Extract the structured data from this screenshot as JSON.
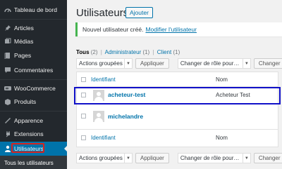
{
  "sidebar": {
    "items": [
      {
        "label": "Tableau de bord",
        "icon": "dashboard-icon"
      },
      {
        "label": "Articles",
        "icon": "pin-icon"
      },
      {
        "label": "Médias",
        "icon": "media-icon"
      },
      {
        "label": "Pages",
        "icon": "pages-icon"
      },
      {
        "label": "Commentaires",
        "icon": "comment-icon"
      },
      {
        "label": "WooCommerce",
        "icon": "woocommerce-icon"
      },
      {
        "label": "Produits",
        "icon": "products-icon"
      },
      {
        "label": "Apparence",
        "icon": "appearance-icon"
      },
      {
        "label": "Extensions",
        "icon": "plugins-icon"
      },
      {
        "label": "Utilisateurs",
        "icon": "users-icon"
      }
    ],
    "submenu_label": "Tous les utilisateurs",
    "active_color": "#0073aa"
  },
  "header": {
    "title": "Utilisateurs",
    "add_button": "Ajouter"
  },
  "notice": {
    "text": "Nouvel utilisateur créé.",
    "link": "Modifier l'utilisateur"
  },
  "filters": {
    "all": "Tous",
    "all_count": "(2)",
    "admin": "Administrateur",
    "admin_count": "(1)",
    "client": "Client",
    "client_count": "(1)",
    "separator": "|"
  },
  "toolbar_top": {
    "bulk_select": "Actions groupées",
    "apply": "Appliquer",
    "role_select": "Changer de rôle pour…",
    "change": "Changer"
  },
  "toolbar_bottom": {
    "bulk_select": "Actions groupées",
    "apply": "Appliquer",
    "role_select": "Changer de rôle pour…",
    "change": "Changer"
  },
  "table": {
    "columns": [
      "Identifiant",
      "Nom"
    ],
    "rows": [
      {
        "username": "acheteur-test",
        "name": "Acheteur Test"
      },
      {
        "username": "michelandre",
        "name": ""
      }
    ]
  },
  "colors": {
    "link": "#0073aa",
    "sidebar_bg": "#23282d",
    "notice_border": "#46b450",
    "annotation_red": "#d9231d",
    "annotation_blue": "#1010c8"
  }
}
